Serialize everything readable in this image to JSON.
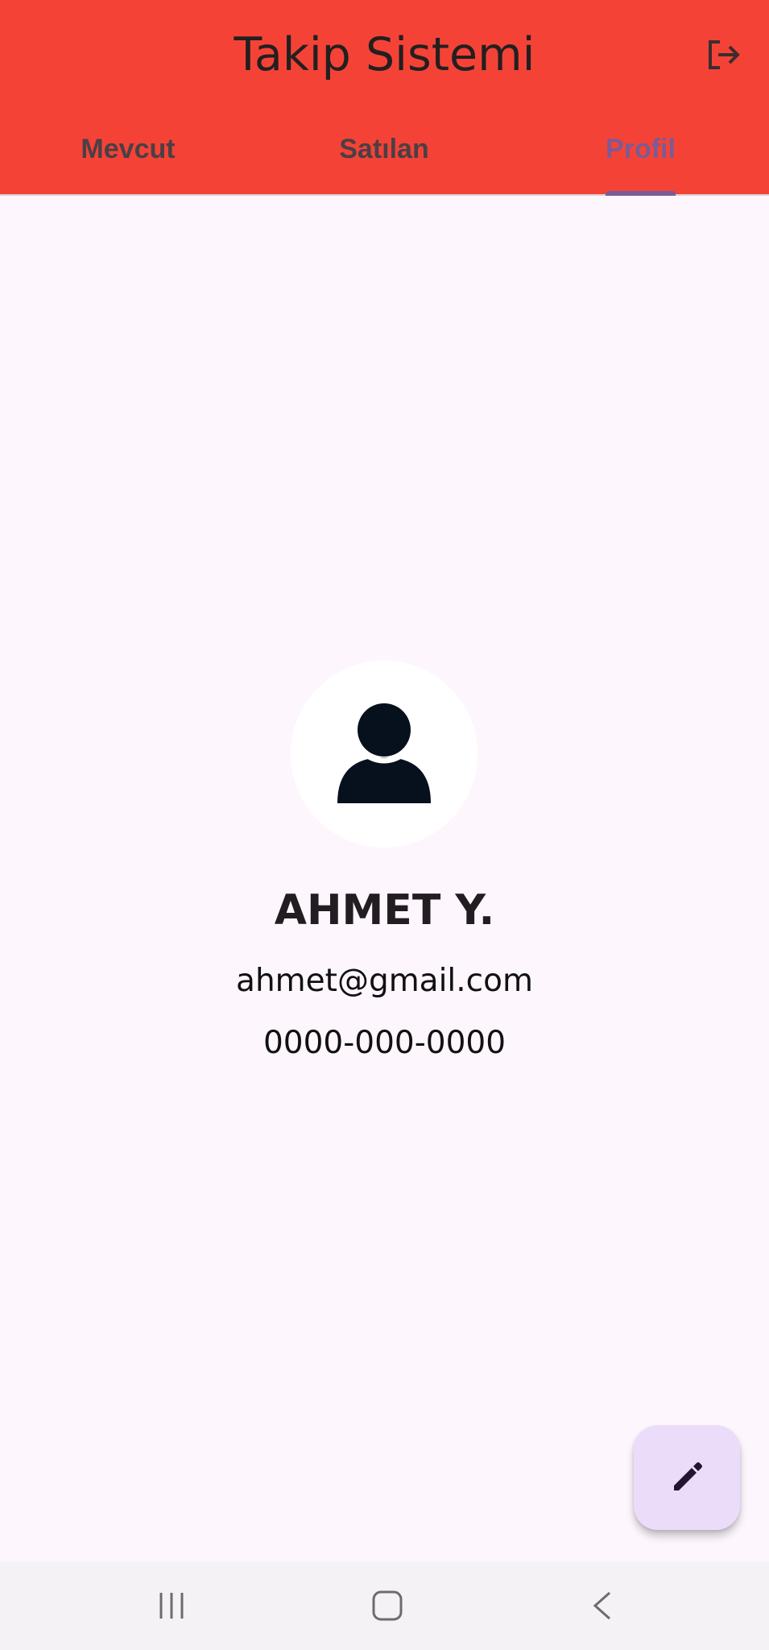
{
  "header": {
    "title": "Takip Sistemi",
    "logout_icon": "logout-icon",
    "color": "#f44336"
  },
  "tabs": [
    {
      "label": "Mevcut",
      "active": false
    },
    {
      "label": "Satılan",
      "active": false
    },
    {
      "label": "Profil",
      "active": true
    }
  ],
  "profile": {
    "avatar_icon": "person-icon",
    "name": "AHMET Y.",
    "email": "ahmet@gmail.com",
    "phone": "0000-000-0000"
  },
  "fab": {
    "icon": "edit-icon",
    "color": "#ebddfa"
  },
  "system_nav": {
    "recent_icon": "recent-apps-icon",
    "home_icon": "home-icon",
    "back_icon": "back-icon"
  },
  "colors": {
    "accent": "#7c5b95",
    "background": "#fdf7fd"
  }
}
